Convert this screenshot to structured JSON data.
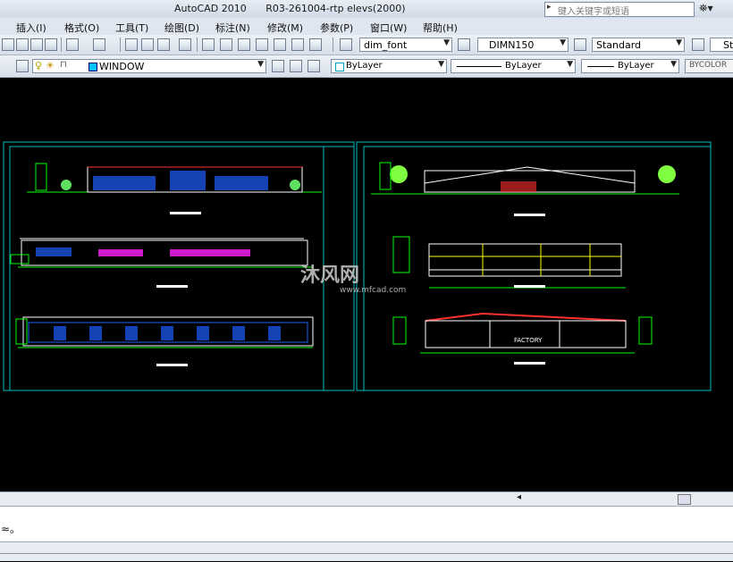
{
  "window": {
    "app_title": "AutoCAD 2010",
    "file_title": "R03-261004-rtp elevs(2000)",
    "search_placeholder": "键入关键字或短语"
  },
  "menu": [
    "插入(I)",
    "格式(O)",
    "工具(T)",
    "绘图(D)",
    "标注(N)",
    "修改(M)",
    "参数(P)",
    "窗口(W)",
    "帮助(H)"
  ],
  "toolbar": {
    "text_style": "dim_font",
    "dim_style": "DIMN150",
    "table_style": "Standard",
    "multileader_style": "St"
  },
  "layers": {
    "current_layer": "WINDOW",
    "color": "ByLayer",
    "linetype": "ByLayer",
    "lineweight": "ByLayer",
    "plot_style": "BYCOLOR"
  },
  "drawing": {
    "watermark": "沐风网",
    "watermark_url": "www.mfcad.com",
    "factory_label": "FACTORY",
    "accent_colors": {
      "frame": "#00c0c0",
      "dim": "#00ff00",
      "wall": "#ffffff",
      "roof": "#ff3030",
      "glass": "#2060ff"
    }
  },
  "command_line": {
    "text": "≈。"
  }
}
